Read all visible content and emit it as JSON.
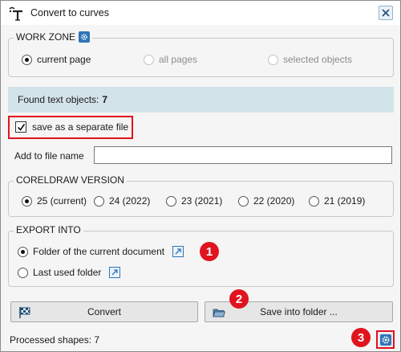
{
  "window": {
    "title": "Convert to curves",
    "icon": "convert-curves-app-icon",
    "close_icon": "close-icon"
  },
  "work_zone": {
    "title": "WORK ZONE",
    "settings_icon": "gear-icon",
    "options": [
      {
        "label": "current page",
        "selected": true,
        "enabled": true
      },
      {
        "label": "all pages",
        "selected": false,
        "enabled": false
      },
      {
        "label": "selected objects",
        "selected": false,
        "enabled": false
      }
    ]
  },
  "found": {
    "label": "Found text objects:",
    "count": "7"
  },
  "separate_file": {
    "label": "save as a separate file",
    "checked": true
  },
  "add_to_name": {
    "label": "Add to file name",
    "value": "",
    "placeholder": ""
  },
  "version": {
    "title": "CORELDRAW VERSION",
    "options": [
      {
        "label": "25 (current)",
        "selected": true
      },
      {
        "label": "24 (2022)",
        "selected": false
      },
      {
        "label": "23 (2021)",
        "selected": false
      },
      {
        "label": "22 (2020)",
        "selected": false
      },
      {
        "label": "21 (2019)",
        "selected": false
      }
    ]
  },
  "export": {
    "title": "EXPORT INTO",
    "options": [
      {
        "label": "Folder of the current document",
        "selected": true,
        "icon": "open-external-icon"
      },
      {
        "label": "Last used folder",
        "selected": false,
        "icon": "open-external-icon"
      }
    ]
  },
  "buttons": {
    "convert": {
      "label": "Convert",
      "icon": "checkered-flag-icon"
    },
    "save_folder": {
      "label": "Save into folder ...",
      "icon": "folder-icon"
    }
  },
  "status": {
    "text": "Processed shapes: 7"
  },
  "annotations": [
    "1",
    "2",
    "3"
  ],
  "colors": {
    "accent": "#2e75b6",
    "highlight": "#e0141e",
    "info_bar": "#d3e3ea"
  }
}
